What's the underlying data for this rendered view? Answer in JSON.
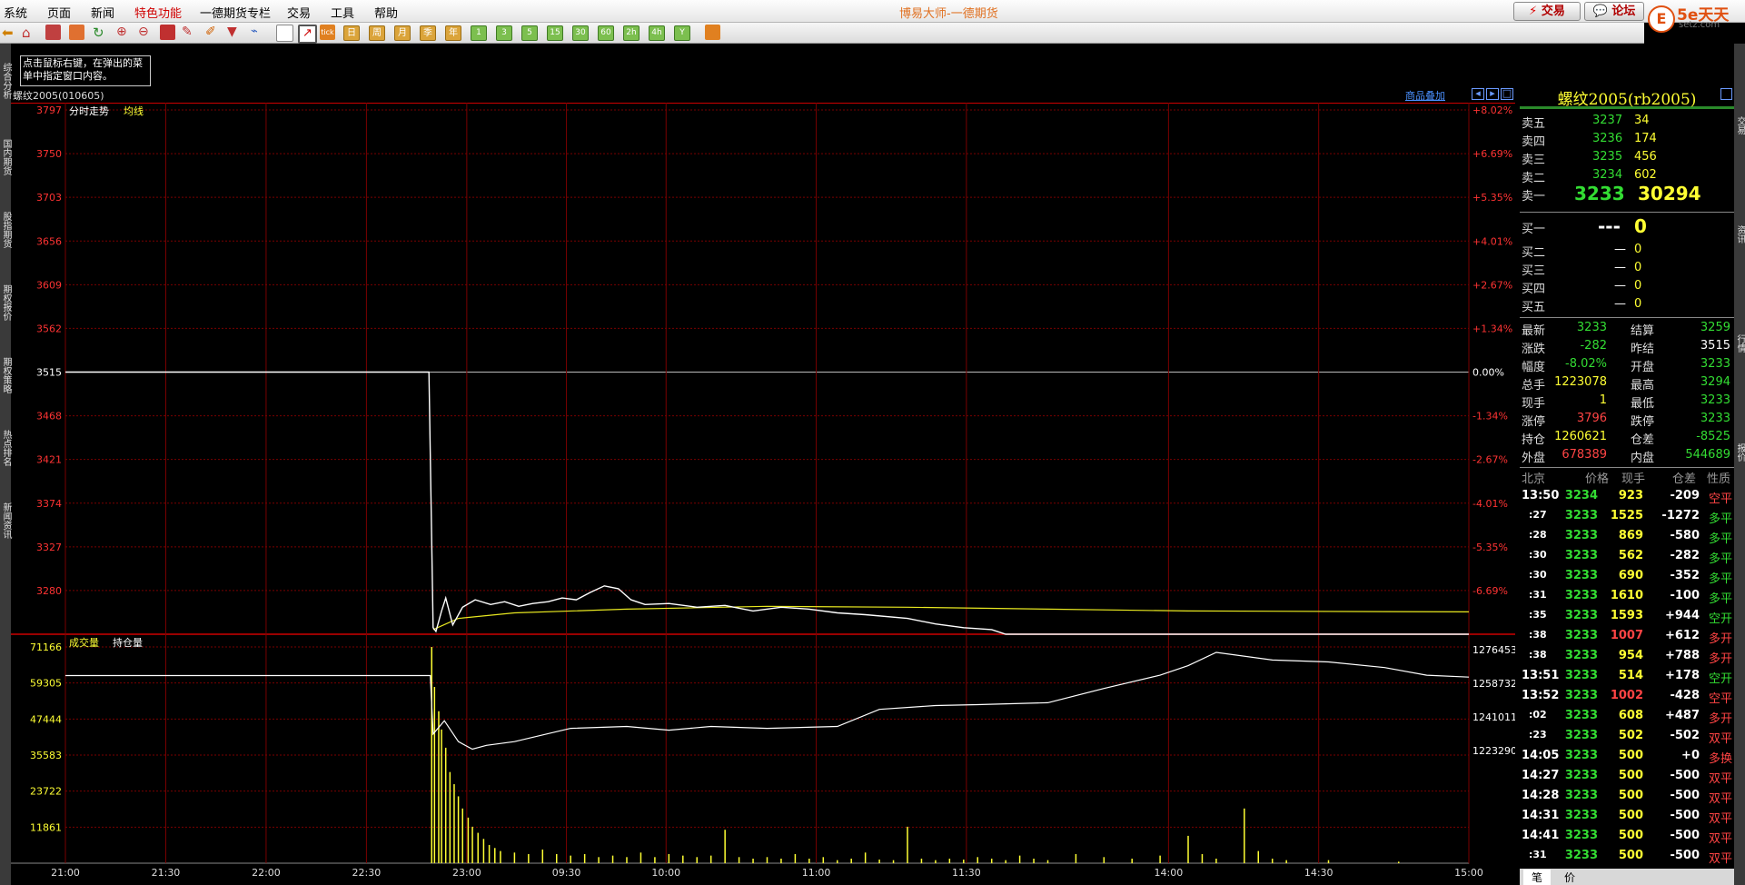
{
  "menu": [
    "系统",
    "页面",
    "新闻",
    "特色功能",
    "一德期货专栏",
    "交易",
    "工具",
    "帮助"
  ],
  "app_title": "博易大师-一德期货",
  "top_buttons": {
    "trade": "交易",
    "forum": "论坛"
  },
  "logo": {
    "mark": "E",
    "text": "5e天天",
    "sub": "setz.com"
  },
  "toolbar_periods": [
    "日",
    "周",
    "月",
    "季",
    "年"
  ],
  "toolbar_minutes": [
    "1",
    "3",
    "5",
    "15",
    "30",
    "60",
    "2h",
    "4h",
    "Y"
  ],
  "tooltip": "点击鼠标右键，在弹出的菜单中指定窗口内容。",
  "left_tabs": [
    "综合分析",
    "国内期货",
    "股指期货",
    "期权报价",
    "期权策略",
    "热点排名",
    "新闻资讯"
  ],
  "right_tabs": [
    "交易",
    "资讯",
    "行情",
    "报价"
  ],
  "chart_header": {
    "symbol": "螺纹2005(010605)",
    "overlay": "商品叠加"
  },
  "price_chart": {
    "label": "分时走势",
    "avg_label": "均线"
  },
  "volume_chart": {
    "label": "成交量",
    "oi_label": "持仓量"
  },
  "chart_data": {
    "type": "line",
    "price_axis": {
      "ticks": [
        "3797",
        "3750",
        "3703",
        "3656",
        "3609",
        "3562",
        "3515",
        "3468",
        "3421",
        "3374",
        "3327",
        "3280"
      ],
      "pct": [
        "+8.02%",
        "+6.69%",
        "+5.35%",
        "+4.01%",
        "+2.67%",
        "+1.34%",
        "0.00%",
        "-1.34%",
        "-2.67%",
        "-4.01%",
        "-5.35%",
        "-6.69%"
      ],
      "ylim": [
        3233,
        3797
      ],
      "base": 3515
    },
    "volume_axis": {
      "ticks": [
        "71166",
        "59305",
        "47444",
        "35583",
        "23722",
        "11861"
      ],
      "ylim": [
        0,
        71166
      ]
    },
    "oi_axis": {
      "ticks": [
        "1276453",
        "1258732",
        "1241011",
        "1223290"
      ]
    },
    "time_labels": [
      "21:00",
      "21:30",
      "22:00",
      "22:30",
      "23:00",
      "09:30",
      "10:00",
      "11:00",
      "11:30",
      "14:00",
      "14:30",
      "15:00"
    ],
    "price_series": [
      [
        0,
        3515
      ],
      [
        0.259,
        3515
      ],
      [
        0.262,
        3240
      ],
      [
        0.264,
        3236
      ],
      [
        0.268,
        3258
      ],
      [
        0.271,
        3272
      ],
      [
        0.276,
        3243
      ],
      [
        0.283,
        3262
      ],
      [
        0.292,
        3270
      ],
      [
        0.303,
        3265
      ],
      [
        0.313,
        3268
      ],
      [
        0.323,
        3263
      ],
      [
        0.333,
        3266
      ],
      [
        0.344,
        3268
      ],
      [
        0.354,
        3272
      ],
      [
        0.364,
        3270
      ],
      [
        0.374,
        3278
      ],
      [
        0.384,
        3285
      ],
      [
        0.394,
        3282
      ],
      [
        0.403,
        3270
      ],
      [
        0.413,
        3265
      ],
      [
        0.43,
        3266
      ],
      [
        0.45,
        3262
      ],
      [
        0.47,
        3264
      ],
      [
        0.49,
        3258
      ],
      [
        0.51,
        3262
      ],
      [
        0.53,
        3260
      ],
      [
        0.55,
        3256
      ],
      [
        0.57,
        3254
      ],
      [
        0.6,
        3250
      ],
      [
        0.62,
        3244
      ],
      [
        0.64,
        3240
      ],
      [
        0.66,
        3238
      ],
      [
        0.67,
        3233
      ],
      [
        1.0,
        3233
      ]
    ],
    "avg_series": [
      [
        0.262,
        3238
      ],
      [
        0.28,
        3250
      ],
      [
        0.32,
        3256
      ],
      [
        0.4,
        3260
      ],
      [
        0.5,
        3263
      ],
      [
        0.6,
        3262
      ],
      [
        0.7,
        3260
      ],
      [
        0.8,
        3258
      ],
      [
        1.0,
        3257
      ]
    ],
    "oi_series": [
      [
        0,
        1262800
      ],
      [
        0.26,
        1262800
      ],
      [
        0.262,
        1232000
      ],
      [
        0.27,
        1239000
      ],
      [
        0.28,
        1228000
      ],
      [
        0.29,
        1224000
      ],
      [
        0.3,
        1226000
      ],
      [
        0.32,
        1228000
      ],
      [
        0.36,
        1235000
      ],
      [
        0.4,
        1236000
      ],
      [
        0.43,
        1234000
      ],
      [
        0.46,
        1236000
      ],
      [
        0.5,
        1235000
      ],
      [
        0.55,
        1236000
      ],
      [
        0.58,
        1245000
      ],
      [
        0.62,
        1247000
      ],
      [
        0.65,
        1247500
      ],
      [
        0.7,
        1248500
      ],
      [
        0.74,
        1256000
      ],
      [
        0.78,
        1263000
      ],
      [
        0.8,
        1268000
      ],
      [
        0.82,
        1275000
      ],
      [
        0.86,
        1271000
      ],
      [
        0.9,
        1270000
      ],
      [
        0.94,
        1267000
      ],
      [
        0.97,
        1263000
      ],
      [
        1.0,
        1262000
      ]
    ],
    "volume_points": [
      [
        0.261,
        71166
      ],
      [
        0.263,
        58000
      ],
      [
        0.266,
        50000
      ],
      [
        0.268,
        44000
      ],
      [
        0.271,
        38000
      ],
      [
        0.274,
        30000
      ],
      [
        0.277,
        26000
      ],
      [
        0.28,
        22000
      ],
      [
        0.283,
        18000
      ],
      [
        0.287,
        15000
      ],
      [
        0.29,
        12000
      ],
      [
        0.294,
        10000
      ],
      [
        0.298,
        8000
      ],
      [
        0.302,
        6000
      ],
      [
        0.306,
        5000
      ],
      [
        0.31,
        4000
      ],
      [
        0.32,
        3500
      ],
      [
        0.33,
        3000
      ],
      [
        0.34,
        4500
      ],
      [
        0.35,
        3000
      ],
      [
        0.36,
        2500
      ],
      [
        0.37,
        3000
      ],
      [
        0.38,
        2000
      ],
      [
        0.39,
        2500
      ],
      [
        0.4,
        2000
      ],
      [
        0.41,
        3500
      ],
      [
        0.42,
        2000
      ],
      [
        0.43,
        3000
      ],
      [
        0.44,
        2500
      ],
      [
        0.45,
        2000
      ],
      [
        0.46,
        2500
      ],
      [
        0.47,
        11000
      ],
      [
        0.48,
        2000
      ],
      [
        0.49,
        1500
      ],
      [
        0.5,
        2000
      ],
      [
        0.51,
        1500
      ],
      [
        0.52,
        3000
      ],
      [
        0.53,
        1500
      ],
      [
        0.54,
        2000
      ],
      [
        0.55,
        1000
      ],
      [
        0.56,
        1500
      ],
      [
        0.57,
        3500
      ],
      [
        0.58,
        1200
      ],
      [
        0.59,
        1000
      ],
      [
        0.6,
        12000
      ],
      [
        0.61,
        1500
      ],
      [
        0.62,
        1000
      ],
      [
        0.63,
        1500
      ],
      [
        0.64,
        1200
      ],
      [
        0.65,
        2000
      ],
      [
        0.66,
        1500
      ],
      [
        0.67,
        1000
      ],
      [
        0.68,
        2500
      ],
      [
        0.69,
        1500
      ],
      [
        0.7,
        1000
      ],
      [
        0.72,
        3000
      ],
      [
        0.74,
        2000
      ],
      [
        0.76,
        1500
      ],
      [
        0.78,
        2500
      ],
      [
        0.8,
        9000
      ],
      [
        0.81,
        3000
      ],
      [
        0.82,
        1500
      ],
      [
        0.84,
        18000
      ],
      [
        0.85,
        4000
      ],
      [
        0.86,
        1500
      ],
      [
        0.87,
        1000
      ],
      [
        0.9,
        1000
      ],
      [
        0.95,
        500
      ]
    ]
  },
  "quote": {
    "title": "螺纹2005(rb2005)",
    "asks": [
      {
        "label": "卖五",
        "price": "3237",
        "vol": "34"
      },
      {
        "label": "卖四",
        "price": "3236",
        "vol": "174"
      },
      {
        "label": "卖三",
        "price": "3235",
        "vol": "456"
      },
      {
        "label": "卖二",
        "price": "3234",
        "vol": "602"
      },
      {
        "label": "卖一",
        "price": "3233",
        "vol": "30294"
      }
    ],
    "bids": [
      {
        "label": "买一",
        "price": "---",
        "vol": "0"
      },
      {
        "label": "买二",
        "price": "—",
        "vol": "0"
      },
      {
        "label": "买三",
        "price": "—",
        "vol": "0"
      },
      {
        "label": "买四",
        "price": "—",
        "vol": "0"
      },
      {
        "label": "买五",
        "price": "—",
        "vol": "0"
      }
    ],
    "stats": [
      {
        "l1": "最新",
        "v1": "3233",
        "c1": "g",
        "l2": "结算",
        "v2": "3259",
        "c2": "g"
      },
      {
        "l1": "涨跌",
        "v1": "-282",
        "c1": "g",
        "l2": "昨结",
        "v2": "3515",
        "c2": "w"
      },
      {
        "l1": "幅度",
        "v1": "-8.02%",
        "c1": "g",
        "l2": "开盘",
        "v2": "3233",
        "c2": "g"
      },
      {
        "l1": "总手",
        "v1": "1223078",
        "c1": "y",
        "l2": "最高",
        "v2": "3294",
        "c2": "g"
      },
      {
        "l1": "现手",
        "v1": "1",
        "c1": "y",
        "l2": "最低",
        "v2": "3233",
        "c2": "g"
      },
      {
        "l1": "涨停",
        "v1": "3796",
        "c1": "r",
        "l2": "跌停",
        "v2": "3233",
        "c2": "g"
      },
      {
        "l1": "持仓",
        "v1": "1260621",
        "c1": "y",
        "l2": "仓差",
        "v2": "-8525",
        "c2": "g"
      },
      {
        "l1": "外盘",
        "v1": "678389",
        "c1": "r",
        "l2": "内盘",
        "v2": "544689",
        "c2": "g"
      }
    ],
    "tick_header": [
      "北京",
      "价格",
      "现手",
      "仓差",
      "性质"
    ],
    "ticks": [
      {
        "t": "13:50",
        "p": "3234",
        "v": "923",
        "d": "-209",
        "n": "空平",
        "nc": "r"
      },
      {
        "t": ":27",
        "p": "3233",
        "v": "1525",
        "d": "-1272",
        "n": "多平",
        "nc": "g"
      },
      {
        "t": ":28",
        "p": "3233",
        "v": "869",
        "d": "-580",
        "n": "多平",
        "nc": "g"
      },
      {
        "t": ":30",
        "p": "3233",
        "v": "562",
        "d": "-282",
        "n": "多平",
        "nc": "g"
      },
      {
        "t": ":30",
        "p": "3233",
        "v": "690",
        "d": "-352",
        "n": "多平",
        "nc": "g"
      },
      {
        "t": ":31",
        "p": "3233",
        "v": "1610",
        "d": "-100",
        "n": "多平",
        "nc": "g"
      },
      {
        "t": ":35",
        "p": "3233",
        "v": "1593",
        "d": "+944",
        "n": "空开",
        "nc": "g"
      },
      {
        "t": ":38",
        "p": "3233",
        "v": "1007",
        "d": "+612",
        "n": "多开",
        "nc": "r"
      },
      {
        "t": ":38",
        "p": "3233",
        "v": "954",
        "d": "+788",
        "n": "多开",
        "nc": "r"
      },
      {
        "t": "13:51",
        "p": "3233",
        "v": "514",
        "d": "+178",
        "n": "空开",
        "nc": "g"
      },
      {
        "t": "13:52",
        "p": "3233",
        "v": "1002",
        "d": "-428",
        "n": "空平",
        "nc": "r"
      },
      {
        "t": ":02",
        "p": "3233",
        "v": "608",
        "d": "+487",
        "n": "多开",
        "nc": "r"
      },
      {
        "t": ":23",
        "p": "3233",
        "v": "502",
        "d": "-502",
        "n": "双平",
        "nc": "r"
      },
      {
        "t": "14:05",
        "p": "3233",
        "v": "500",
        "d": "+0",
        "n": "多换",
        "nc": "r"
      },
      {
        "t": "14:27",
        "p": "3233",
        "v": "500",
        "d": "-500",
        "n": "双平",
        "nc": "r"
      },
      {
        "t": "14:28",
        "p": "3233",
        "v": "500",
        "d": "-500",
        "n": "双平",
        "nc": "r"
      },
      {
        "t": "14:31",
        "p": "3233",
        "v": "500",
        "d": "-500",
        "n": "双平",
        "nc": "r"
      },
      {
        "t": "14:41",
        "p": "3233",
        "v": "500",
        "d": "-500",
        "n": "双平",
        "nc": "r"
      },
      {
        "t": ":31",
        "p": "3233",
        "v": "500",
        "d": "-500",
        "n": "双平",
        "nc": "r"
      }
    ],
    "bottom_tabs": [
      "笔",
      "价"
    ]
  }
}
